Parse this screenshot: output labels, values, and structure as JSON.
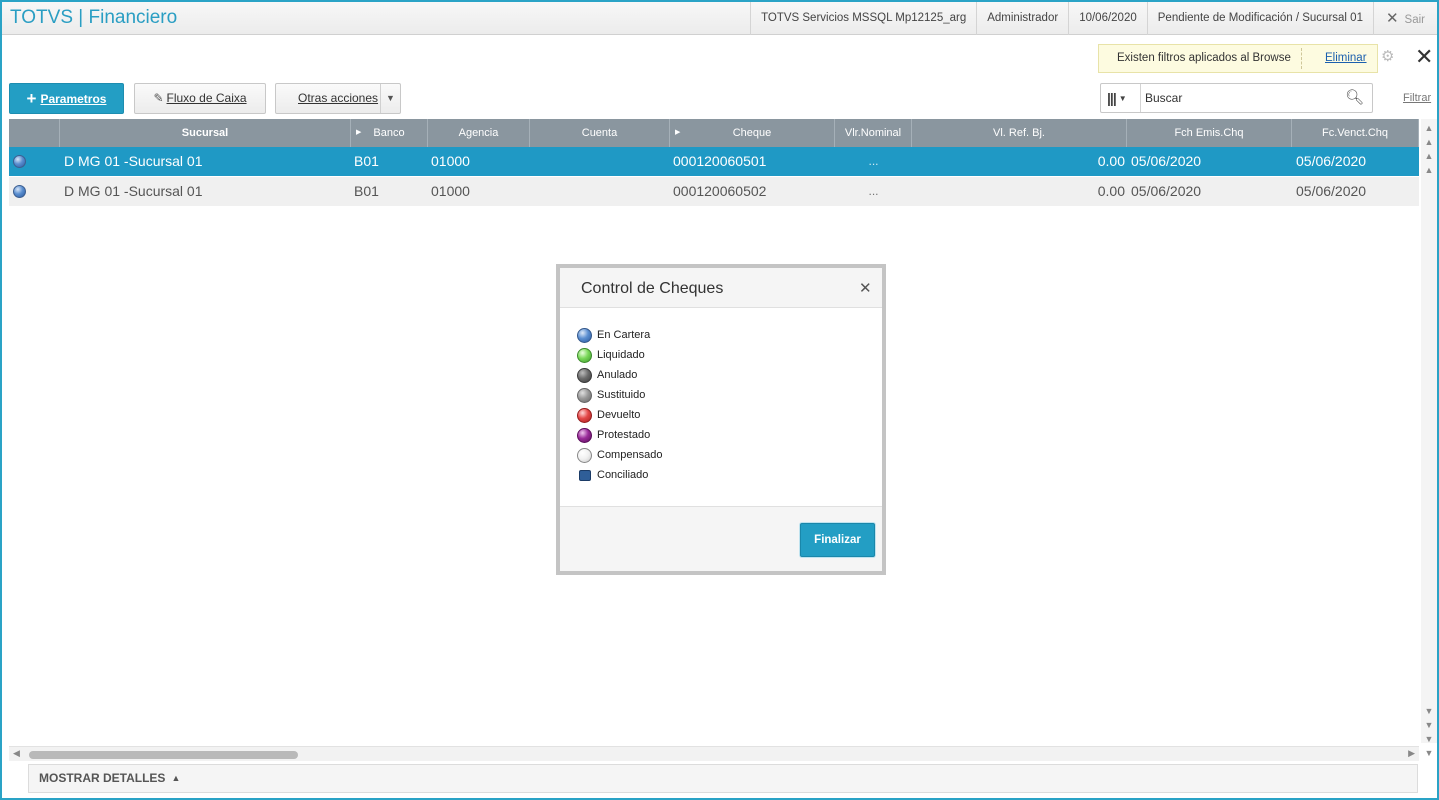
{
  "header": {
    "app_title": "TOTVS | Financiero",
    "server": "TOTVS Servicios MSSQL Mp12125_arg",
    "user": "Administrador",
    "date": "10/06/2020",
    "status": "Pendiente de Modificación / Sucursal 01",
    "exit_label": "Sair"
  },
  "filter_notice": {
    "message": "Existen filtros aplicados al Browse",
    "remove_link": "Eliminar"
  },
  "toolbar": {
    "parametros": "Parametros",
    "fluxo_caixa": "Fluxo de Caixa",
    "otras_acciones": "Otras acciones"
  },
  "search": {
    "placeholder": "Buscar",
    "filter_link": "Filtrar"
  },
  "grid": {
    "columns": [
      "Sucursal",
      "Banco",
      "Agencia",
      "Cuenta",
      "Cheque",
      "Vlr.Nominal",
      "Vl. Ref. Bj.",
      "Fch Emis.Chq",
      "Fc.Venct.Chq"
    ],
    "rows": [
      {
        "sucursal": "D MG 01 -Sucursal 01",
        "banco": "B01",
        "agencia": "01000",
        "cuenta": "",
        "cheque": "000120060501",
        "nominal": "...",
        "ref": "0.00",
        "emision": "05/06/2020",
        "vencimiento": "05/06/2020",
        "status": "En Cartera"
      },
      {
        "sucursal": "D MG 01 -Sucursal 01",
        "banco": "B01",
        "agencia": "01000",
        "cuenta": "",
        "cheque": "000120060502",
        "nominal": "...",
        "ref": "0.00",
        "emision": "05/06/2020",
        "vencimiento": "05/06/2020",
        "status": "En Cartera"
      }
    ]
  },
  "details_bar": {
    "label": "MOSTRAR DETALLES"
  },
  "modal": {
    "title": "Control de Cheques",
    "legend": [
      {
        "label": "En Cartera",
        "color": "#5c8fd1"
      },
      {
        "label": "Liquidado",
        "color": "#7bd85a"
      },
      {
        "label": "Anulado",
        "color": "#6d6d6d"
      },
      {
        "label": "Sustituido",
        "color": "#9a9a9a"
      },
      {
        "label": "Devuelto",
        "color": "#e34848"
      },
      {
        "label": "Protestado",
        "color": "#9a2d9a"
      },
      {
        "label": "Compensado",
        "color": "#f0f0f0"
      },
      {
        "label": "Conciliado",
        "color": "#2f5e98"
      }
    ],
    "finalize_button": "Finalizar"
  },
  "colors": {
    "accent": "#239ec4",
    "selected_row": "#1f99c5",
    "header_gray": "#8a969f"
  }
}
